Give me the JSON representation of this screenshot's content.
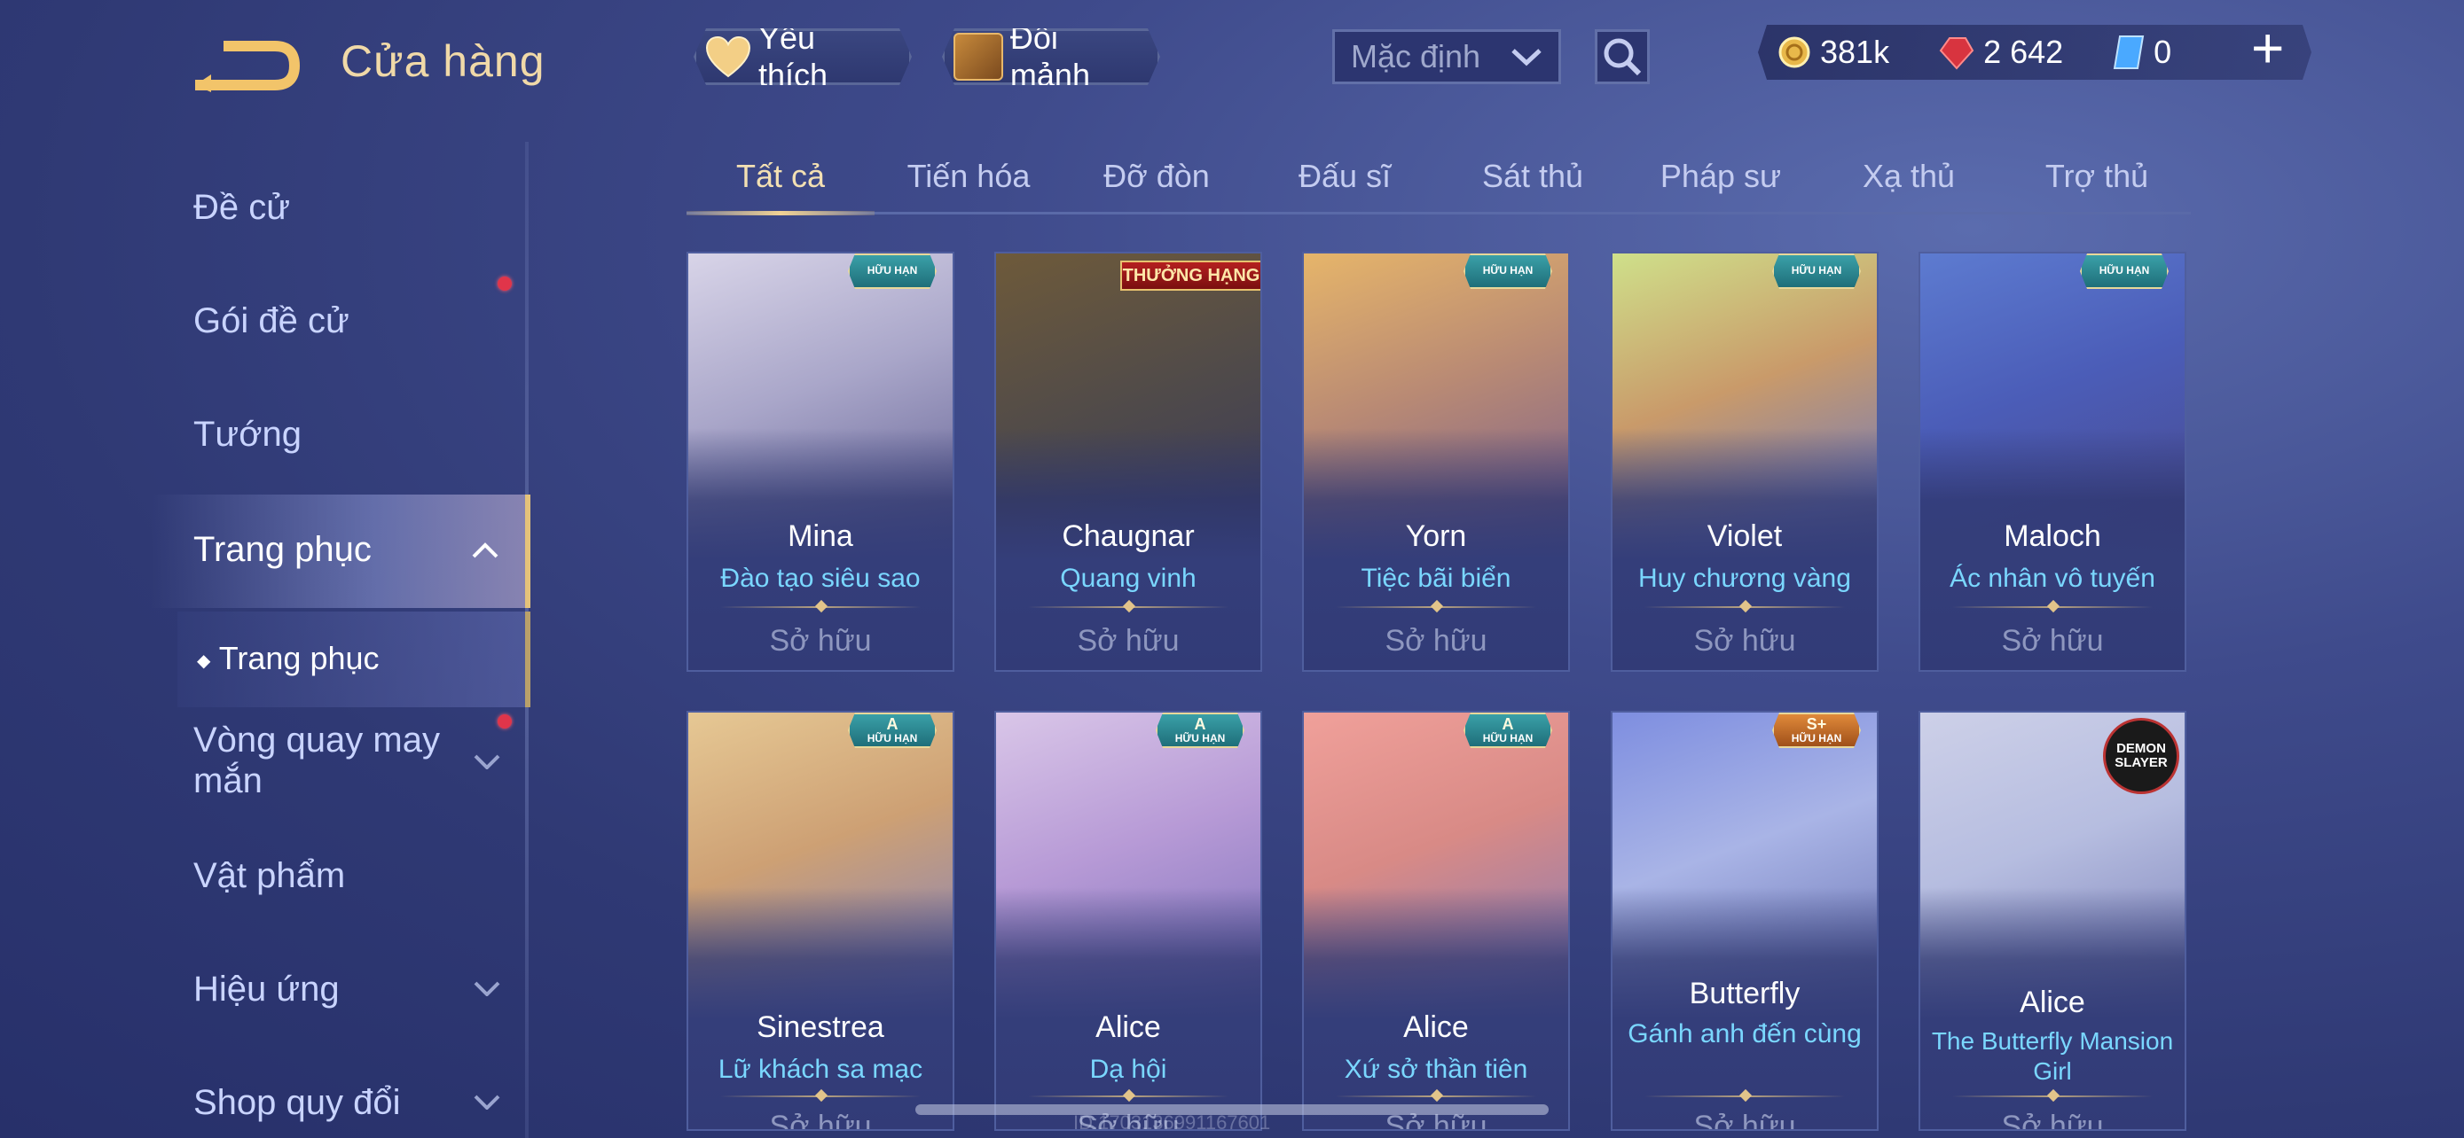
{
  "header": {
    "title": "Cửa hàng",
    "favorites_label": "Yêu thích",
    "exchange_label": "Đổi mảnh",
    "sort_value": "Mặc định"
  },
  "currency": {
    "coins": "381k",
    "gems": "2 642",
    "vouchers": "0"
  },
  "sidebar": {
    "items": [
      {
        "label": "Đề cử"
      },
      {
        "label": "Gói đề cử",
        "dot": true
      },
      {
        "label": "Tướng"
      },
      {
        "label": "Trang phục",
        "active": true,
        "expanded": true
      },
      {
        "label": "Trang phục",
        "sub": true
      },
      {
        "label": "Vòng quay may mắn",
        "dot": true,
        "collapsed": true
      },
      {
        "label": "Vật phẩm"
      },
      {
        "label": "Hiệu ứng",
        "collapsed": true
      },
      {
        "label": "Shop quy đổi",
        "collapsed": true
      }
    ]
  },
  "tabs": [
    "Tất cả",
    "Tiến hóa",
    "Đỡ đòn",
    "Đấu sĩ",
    "Sát thủ",
    "Pháp sư",
    "Xạ thủ",
    "Trợ thủ"
  ],
  "owned_label": "Sở hữu",
  "cards": [
    {
      "hero": "Mina",
      "skin": "Đào tạo siêu sao",
      "badge": "HỮU HẠN",
      "tier": ""
    },
    {
      "hero": "Chaugnar",
      "skin": "Quang vinh",
      "rank_badge": "THƯỞNG HẠNG"
    },
    {
      "hero": "Yorn",
      "skin": "Tiệc bãi biển",
      "badge": "HỮU HẠN",
      "tier": ""
    },
    {
      "hero": "Violet",
      "skin": "Huy chương vàng",
      "badge": "HỮU HẠN",
      "tier": ""
    },
    {
      "hero": "Maloch",
      "skin": "Ác nhân vô tuyến",
      "badge": "HỮU HẠN",
      "tier": ""
    },
    {
      "hero": "Sinestrea",
      "skin": "Lữ khách sa mạc",
      "badge": "HỮU HẠN",
      "tier": "A"
    },
    {
      "hero": "Alice",
      "skin": "Dạ hội",
      "badge": "HỮU HẠN",
      "tier": "A"
    },
    {
      "hero": "Alice",
      "skin": "Xứ sở thần tiên",
      "badge": "HỮU HẠN",
      "tier": "A"
    },
    {
      "hero": "Butterfly",
      "skin": "Gánh anh đến cùng",
      "badge": "HỮU HẠN",
      "tier": "S+"
    },
    {
      "hero": "Alice",
      "skin": "The Butterfly Mansion Girl",
      "logo": "DEMON SLAYER"
    }
  ],
  "watermark": "ID:1703136991167601",
  "colors": {
    "accent_gold": "#f2d394",
    "skin_name": "#7ad7ff",
    "background": "#3f4b8c"
  }
}
